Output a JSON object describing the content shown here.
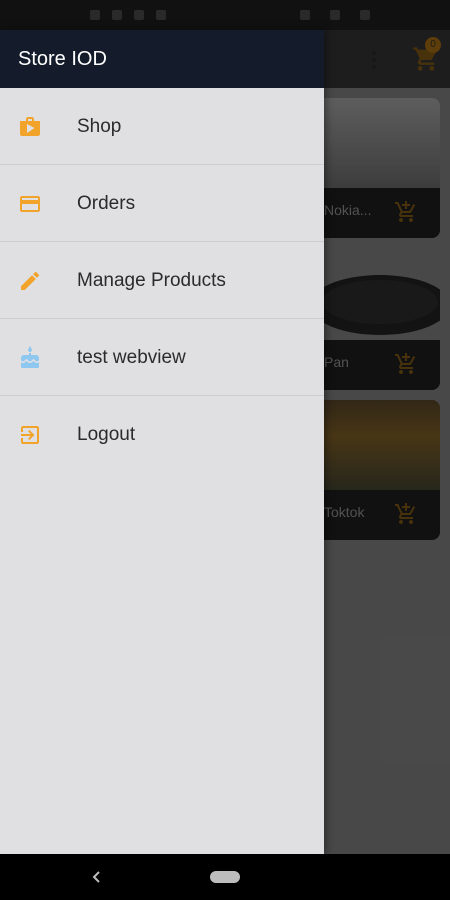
{
  "app": {
    "title": "Store IOD"
  },
  "toolbar": {
    "cart_count": "0"
  },
  "drawer": {
    "items": [
      {
        "label": "Shop",
        "icon": "shop-icon"
      },
      {
        "label": "Orders",
        "icon": "credit-card-icon"
      },
      {
        "label": "Manage Products",
        "icon": "edit-icon"
      },
      {
        "label": "test webview",
        "icon": "cake-icon"
      },
      {
        "label": "Logout",
        "icon": "logout-icon"
      }
    ]
  },
  "products": [
    {
      "name": "Nokia..."
    },
    {
      "name": "Pan"
    },
    {
      "name": "Toktok"
    }
  ],
  "colors": {
    "accent": "#f2a32a",
    "drawer_header": "#141c2b",
    "drawer_bg": "#e0e0e3"
  }
}
